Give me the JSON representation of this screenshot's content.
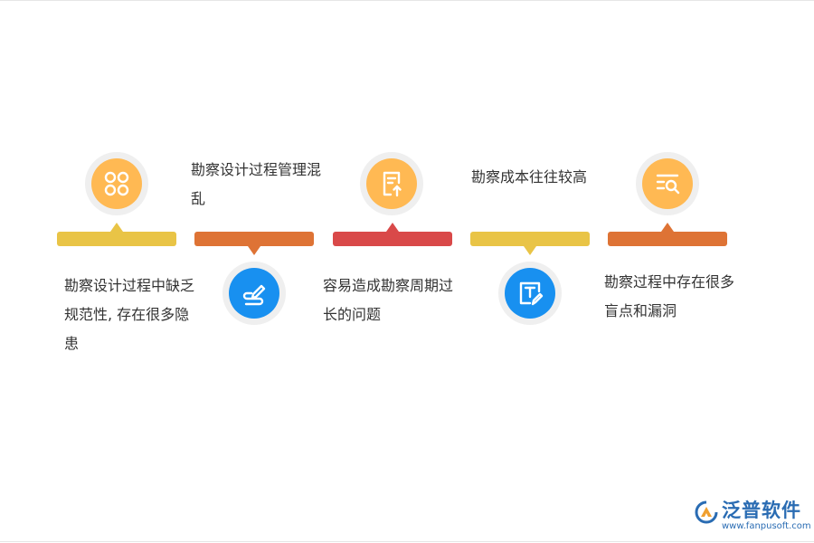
{
  "colors": {
    "yellow": "#e9c446",
    "orange": "#de7335",
    "red": "#d94949",
    "icon_yellow": "#ffb953",
    "icon_blue": "#1890f0",
    "brand_blue": "#2a6cb3"
  },
  "steps": [
    {
      "text": "勘察设计过程中缺乏规范性, 存在很多隐患",
      "icon": "apps-grid-icon",
      "bar_color": "yellow"
    },
    {
      "text": "勘察设计过程管理混乱",
      "icon": "pen-signature-icon",
      "bar_color": "orange"
    },
    {
      "text": "容易造成勘察周期过长的问题",
      "icon": "document-upload-icon",
      "bar_color": "red"
    },
    {
      "text": "勘察成本往往较高",
      "icon": "text-edit-icon",
      "bar_color": "yellow"
    },
    {
      "text": "勘察过程中存在很多盲点和漏洞",
      "icon": "search-list-icon",
      "bar_color": "orange"
    }
  ],
  "brand": {
    "name": "泛普软件",
    "url": "www.fanpusoft.com"
  }
}
